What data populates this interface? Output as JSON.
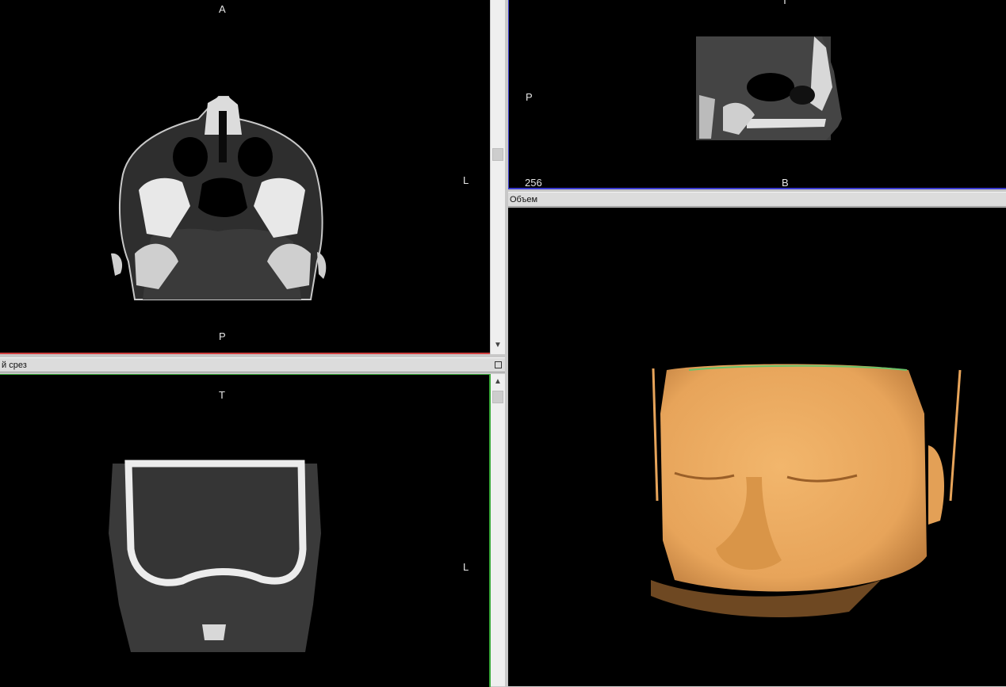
{
  "axial_view": {
    "label_top": "A",
    "label_right": "L",
    "label_bottom": "P"
  },
  "sagittal_view": {
    "label_top": "T",
    "label_left": "P",
    "label_bottom": "B",
    "slice_number": "256"
  },
  "coronal_view": {
    "title": "й срез",
    "label_top": "T",
    "label_right": "L"
  },
  "volume_view": {
    "title": "Объем"
  },
  "colors": {
    "axial_border": "#d04040",
    "sagittal_border": "#3a3ad0",
    "coronal_border": "#3aa83a",
    "volume_skin": "#e7a45a"
  },
  "icons": {
    "scroll_up": "chevron-up-icon",
    "scroll_down": "chevron-down-icon",
    "restore": "window-restore-icon"
  }
}
